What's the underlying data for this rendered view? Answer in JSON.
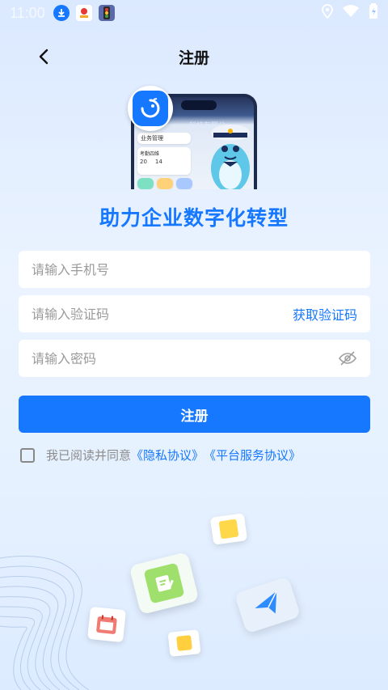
{
  "status_bar": {
    "time": "11:00"
  },
  "header": {
    "title": "注册"
  },
  "hero": {
    "phone_label": "科技有限公",
    "card_title": "业务管理",
    "card_sub": "考勤四维",
    "num_a": "20",
    "num_b": "14"
  },
  "slogan": "助力企业数字化转型",
  "form": {
    "phone_placeholder": "请输入手机号",
    "code_placeholder": "请输入验证码",
    "get_code_label": "获取验证码",
    "password_placeholder": "请输入密码",
    "submit_label": "注册"
  },
  "agreement": {
    "prefix": "我已阅读并同意",
    "privacy_link": "《隐私协议》",
    "service_link": "《平台服务协议》"
  },
  "colors": {
    "accent": "#1677ff",
    "background_top": "#dbe9ff"
  }
}
